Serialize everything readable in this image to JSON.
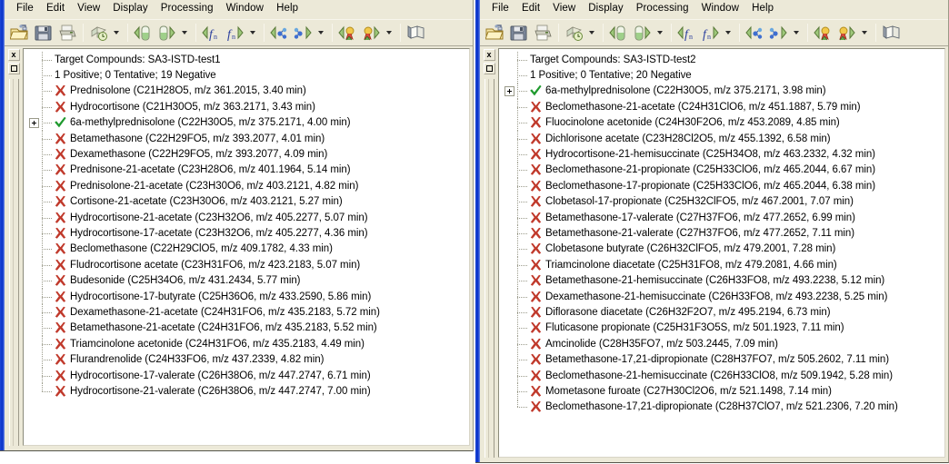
{
  "app": {
    "accent_blue": "#0a33c8",
    "chrome_bg": "#ece9d8",
    "negative_color": "#c0392b",
    "positive_color": "#1f9a2e"
  },
  "menubar": {
    "items": [
      {
        "label": "File"
      },
      {
        "label": "Edit"
      },
      {
        "label": "View"
      },
      {
        "label": "Display"
      },
      {
        "label": "Processing"
      },
      {
        "label": "Window"
      },
      {
        "label": "Help"
      }
    ]
  },
  "toolbar": {
    "buttons": [
      {
        "name": "open-folder-icon",
        "title": "Open"
      },
      {
        "name": "save-disk-icon",
        "title": "Save"
      },
      {
        "name": "print-icon",
        "title": "Print"
      },
      {
        "name": "history-clock-icon",
        "title": "Recent"
      },
      {
        "name": "previous-sample-icon",
        "title": "Previous Sample"
      },
      {
        "name": "next-sample-icon",
        "title": "Next Sample"
      },
      {
        "name": "previous-function-icon",
        "title": "Previous Function"
      },
      {
        "name": "next-function-icon",
        "title": "Next Function"
      },
      {
        "name": "previous-component-icon",
        "title": "Previous Component"
      },
      {
        "name": "next-component-icon",
        "title": "Next Component"
      },
      {
        "name": "previous-peak-icon",
        "title": "Previous Peak"
      },
      {
        "name": "next-peak-icon",
        "title": "Next Peak"
      },
      {
        "name": "browser-book-icon",
        "title": "Browser"
      }
    ]
  },
  "gutter": {
    "close_label": "x",
    "restore_label": "□"
  },
  "windows": [
    {
      "id": "left",
      "title_row": "Target Compounds: SA3-ISTD-test1",
      "summary_row": "1 Positive; 0 Tentative; 19 Negative",
      "rows": [
        {
          "status": "negative",
          "expandable": false,
          "label": "Prednisolone (C21H28O5, m/z 361.2015, 3.40 min)"
        },
        {
          "status": "negative",
          "expandable": false,
          "label": "Hydrocortisone (C21H30O5, m/z 363.2171, 3.43 min)"
        },
        {
          "status": "positive",
          "expandable": true,
          "label": "6a-methylprednisolone (C22H30O5, m/z 375.2171, 4.00 min)"
        },
        {
          "status": "negative",
          "expandable": false,
          "label": "Betamethasone (C22H29FO5, m/z 393.2077, 4.01 min)"
        },
        {
          "status": "negative",
          "expandable": false,
          "label": "Dexamethasone (C22H29FO5, m/z 393.2077, 4.09 min)"
        },
        {
          "status": "negative",
          "expandable": false,
          "label": "Prednisone-21-acetate (C23H28O6, m/z 401.1964, 5.14 min)"
        },
        {
          "status": "negative",
          "expandable": false,
          "label": "Prednisolone-21-acetate (C23H30O6, m/z 403.2121, 4.82 min)"
        },
        {
          "status": "negative",
          "expandable": false,
          "label": "Cortisone-21-acetate (C23H30O6, m/z 403.2121, 5.27 min)"
        },
        {
          "status": "negative",
          "expandable": false,
          "label": "Hydrocortisone-21-acetate (C23H32O6, m/z 405.2277, 5.07 min)"
        },
        {
          "status": "negative",
          "expandable": false,
          "label": "Hydrocortisone-17-acetate (C23H32O6, m/z 405.2277, 4.36 min)"
        },
        {
          "status": "negative",
          "expandable": false,
          "label": "Beclomethasone (C22H29ClO5, m/z 409.1782, 4.33 min)"
        },
        {
          "status": "negative",
          "expandable": false,
          "label": "Fludrocortisone acetate (C23H31FO6, m/z 423.2183, 5.07 min)"
        },
        {
          "status": "negative",
          "expandable": false,
          "label": "Budesonide (C25H34O6, m/z 431.2434, 5.77 min)"
        },
        {
          "status": "negative",
          "expandable": false,
          "label": "Hydrocortisone-17-butyrate (C25H36O6, m/z 433.2590, 5.86 min)"
        },
        {
          "status": "negative",
          "expandable": false,
          "label": "Dexamethasone-21-acetate (C24H31FO6, m/z 435.2183, 5.72 min)"
        },
        {
          "status": "negative",
          "expandable": false,
          "label": "Betamethasone-21-acetate (C24H31FO6, m/z 435.2183, 5.52 min)"
        },
        {
          "status": "negative",
          "expandable": false,
          "label": "Triamcinolone acetonide (C24H31FO6, m/z 435.2183, 4.49 min)"
        },
        {
          "status": "negative",
          "expandable": false,
          "label": "Flurandrenolide (C24H33FO6, m/z 437.2339, 4.82 min)"
        },
        {
          "status": "negative",
          "expandable": false,
          "label": "Hydrocortisone-17-valerate (C26H38O6, m/z 447.2747, 6.71 min)"
        },
        {
          "status": "negative",
          "expandable": false,
          "label": "Hydrocortisone-21-valerate (C26H38O6, m/z 447.2747, 7.00 min)"
        }
      ]
    },
    {
      "id": "right",
      "title_row": "Target Compounds: SA3-ISTD-test2",
      "summary_row": "1 Positive; 0 Tentative; 20 Negative",
      "rows": [
        {
          "status": "positive",
          "expandable": true,
          "label": "6a-methylprednisolone (C22H30O5, m/z 375.2171, 3.98 min)"
        },
        {
          "status": "negative",
          "expandable": false,
          "label": "Beclomethasone-21-acetate (C24H31ClO6, m/z 451.1887, 5.79 min)"
        },
        {
          "status": "negative",
          "expandable": false,
          "label": "Fluocinolone acetonide (C24H30F2O6, m/z 453.2089, 4.85 min)"
        },
        {
          "status": "negative",
          "expandable": false,
          "label": "Dichlorisone acetate (C23H28Cl2O5, m/z 455.1392, 6.58 min)"
        },
        {
          "status": "negative",
          "expandable": false,
          "label": "Hydrocortisone-21-hemisuccinate (C25H34O8, m/z 463.2332, 4.32 min)"
        },
        {
          "status": "negative",
          "expandable": false,
          "label": "Beclomethasone-21-propionate (C25H33ClO6, m/z 465.2044, 6.67 min)"
        },
        {
          "status": "negative",
          "expandable": false,
          "label": "Beclomethasone-17-propionate (C25H33ClO6, m/z 465.2044, 6.38 min)"
        },
        {
          "status": "negative",
          "expandable": false,
          "label": "Clobetasol-17-propionate (C25H32ClFO5, m/z 467.2001, 7.07 min)"
        },
        {
          "status": "negative",
          "expandable": false,
          "label": "Betamethasone-17-valerate (C27H37FO6, m/z 477.2652, 6.99 min)"
        },
        {
          "status": "negative",
          "expandable": false,
          "label": "Betamethasone-21-valerate (C27H37FO6, m/z 477.2652, 7.11 min)"
        },
        {
          "status": "negative",
          "expandable": false,
          "label": "Clobetasone butyrate (C26H32ClFO5, m/z 479.2001, 7.28 min)"
        },
        {
          "status": "negative",
          "expandable": false,
          "label": "Triamcinolone diacetate (C25H31FO8, m/z 479.2081, 4.66 min)"
        },
        {
          "status": "negative",
          "expandable": false,
          "label": "Betamethasone-21-hemisuccinate (C26H33FO8, m/z 493.2238, 5.12 min)"
        },
        {
          "status": "negative",
          "expandable": false,
          "label": "Dexamethasone-21-hemisuccinate (C26H33FO8, m/z 493.2238, 5.25 min)"
        },
        {
          "status": "negative",
          "expandable": false,
          "label": "Diflorasone diacetate (C26H32F2O7, m/z 495.2194, 6.73 min)"
        },
        {
          "status": "negative",
          "expandable": false,
          "label": "Fluticasone propionate (C25H31F3O5S, m/z 501.1923, 7.11 min)"
        },
        {
          "status": "negative",
          "expandable": false,
          "label": "Amcinolide (C28H35FO7, m/z 503.2445, 7.09 min)"
        },
        {
          "status": "negative",
          "expandable": false,
          "label": "Betamethasone-17,21-dipropionate (C28H37FO7, m/z 505.2602, 7.11 min)"
        },
        {
          "status": "negative",
          "expandable": false,
          "label": "Beclomethasone-21-hemisuccinate (C26H33ClO8, m/z 509.1942, 5.28 min)"
        },
        {
          "status": "negative",
          "expandable": false,
          "label": "Mometasone furoate (C27H30Cl2O6, m/z 521.1498, 7.14 min)"
        },
        {
          "status": "negative",
          "expandable": false,
          "label": "Beclomethasone-17,21-dipropionate (C28H37ClO7, m/z 521.2306, 7.20 min)"
        }
      ]
    }
  ]
}
